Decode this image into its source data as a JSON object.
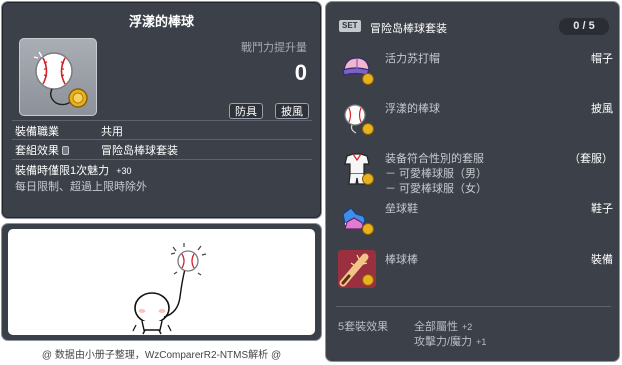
{
  "item_id": "01102593",
  "tooltip": {
    "title": "浮漾的棒球",
    "icon": "baseball-cape-icon",
    "power_label": "戰鬥力提升量",
    "power_value": "0",
    "tags": [
      "防具",
      "披風"
    ],
    "job_label": "裝備職業",
    "job_value": "共用",
    "set_label": "套組效果",
    "set_value": "冒险岛棒球套装",
    "limit_label": "裝備時僅限1次",
    "limit_stat": "魅力",
    "limit_amount": "+30",
    "daily_note": "每日限制、超過上限時除外"
  },
  "credit": "@ 数据由小册子整理，WzComparerR2-NTMS解析 @",
  "set": {
    "badge": "SET",
    "name": "冒险岛棒球套装",
    "count": "0 / 5",
    "items": [
      {
        "name": "活力苏打帽",
        "type": "帽子",
        "icon": "baseball-cap-icon"
      },
      {
        "name": "浮漾的棒球",
        "type": "披風",
        "icon": "baseball-cape-icon"
      },
      {
        "name": "装备符合性別的套服",
        "type": "（套服）",
        "icon": "baseball-uniform-icon",
        "sub": [
          "－ 可愛棒球服（男）",
          "－ 可愛棒球服（女）"
        ]
      },
      {
        "name": "垒球鞋",
        "type": "鞋子",
        "icon": "baseball-shoes-icon"
      },
      {
        "name": "棒球棒",
        "type": "裝備",
        "icon": "baseball-bat-icon"
      }
    ],
    "bonus_label": "5套裝效果",
    "bonus": [
      {
        "stat": "全部屬性",
        "amount": "+2"
      },
      {
        "stat": "攻擊力/魔力",
        "amount": "+1"
      }
    ]
  },
  "colors": {
    "panel_bg": "#3c4149",
    "panel_border": "#8d949e",
    "muted_text": "#c6cbd1",
    "coin_gold": "#e8b21e"
  }
}
